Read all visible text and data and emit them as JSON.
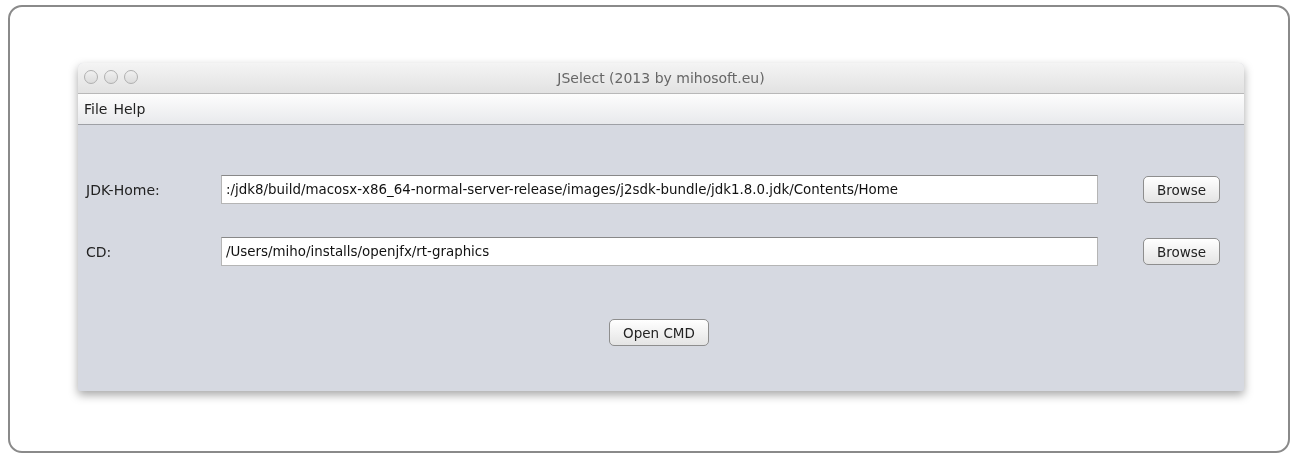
{
  "window": {
    "title": "JSelect (2013 by mihosoft.eu)"
  },
  "menu": [
    "File",
    "Help"
  ],
  "fields": [
    {
      "label": "JDK-Home:",
      "value": ":/jdk8/build/macosx-x86_64-normal-server-release/images/j2sdk-bundle/jdk1.8.0.jdk/Contents/Home",
      "button": "Browse"
    },
    {
      "label": "CD:",
      "value": "/Users/miho/installs/openjfx/rt-graphics",
      "button": "Browse"
    }
  ],
  "action_button": "Open CMD"
}
